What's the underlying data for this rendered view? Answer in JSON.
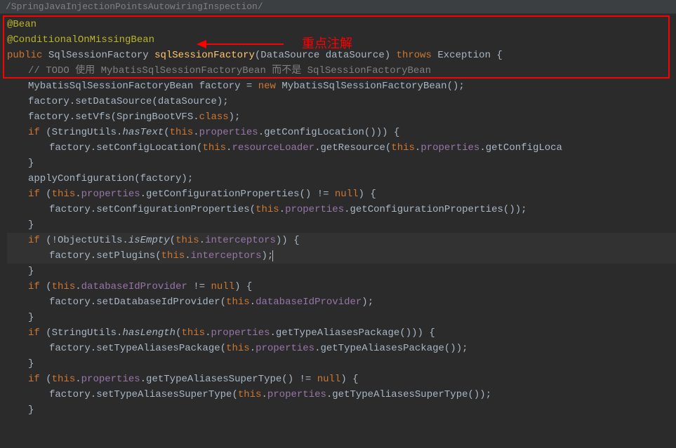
{
  "breadcrumb": "/SpringJavaInjectionPointsAutowiringInspection/",
  "callout": "重点注解",
  "code": {
    "l1_anno1": "@Bean",
    "l2_anno2": "@ConditionalOnMissingBean",
    "l3_kw_public": "public",
    "l3_type": "SqlSessionFactory",
    "l3_name": "sqlSessionFactory",
    "l3_ptype": "DataSource",
    "l3_pname": "dataSource",
    "l3_kw_throws": "throws",
    "l3_exc": "Exception",
    "l4_comment": "// TODO 使用 MybatisSqlSessionFactoryBean 而不是 SqlSessionFactoryBean",
    "l5_type": "MybatisSqlSessionFactoryBean",
    "l5_var": "factory",
    "l5_kw_new": "new",
    "l5_ctor": "MybatisSqlSessionFactoryBean",
    "l6": "factory.setDataSource(dataSource);",
    "l7_a": "factory.setVfs(SpringBootVFS.",
    "l7_kw_class": "class",
    "l7_b": ");",
    "l8_kw_if": "if",
    "l8_a": " (StringUtils.",
    "l8_m": "hasText",
    "l8_b": "(",
    "l8_kw_this": "this",
    "l8_c": ".",
    "l8_f": "properties",
    "l8_d": ".getConfigLocation())) {",
    "l9_a": "factory.setConfigLocation(",
    "l9_kw_this1": "this",
    "l9_b": ".",
    "l9_f1": "resourceLoader",
    "l9_c": ".getResource(",
    "l9_kw_this2": "this",
    "l9_d": ".",
    "l9_f2": "properties",
    "l9_e": ".getConfigLoca",
    "l10": "}",
    "l11": "applyConfiguration(factory);",
    "l12_kw_if": "if",
    "l12_a": " (",
    "l12_kw_this": "this",
    "l12_b": ".",
    "l12_f": "properties",
    "l12_c": ".getConfigurationProperties() != ",
    "l12_kw_null": "null",
    "l12_d": ") {",
    "l13_a": "factory.setConfigurationProperties(",
    "l13_kw_this": "this",
    "l13_b": ".",
    "l13_f": "properties",
    "l13_c": ".getConfigurationProperties());",
    "l14": "}",
    "l15_kw_if": "if",
    "l15_a": " (!ObjectUtils.",
    "l15_m": "isEmpty",
    "l15_b": "(",
    "l15_kw_this": "this",
    "l15_c": ".",
    "l15_f": "interceptors",
    "l15_d": ")) {",
    "l16_a": "factory.setPlugins(",
    "l16_kw_this": "this",
    "l16_b": ".",
    "l16_f": "interceptors",
    "l16_c": ");",
    "l17": "}",
    "l18_kw_if": "if",
    "l18_a": " (",
    "l18_kw_this": "this",
    "l18_b": ".",
    "l18_f": "databaseIdProvider",
    "l18_c": " != ",
    "l18_kw_null": "null",
    "l18_d": ") {",
    "l19_a": "factory.setDatabaseIdProvider(",
    "l19_kw_this": "this",
    "l19_b": ".",
    "l19_f": "databaseIdProvider",
    "l19_c": ");",
    "l20": "}",
    "l21_kw_if": "if",
    "l21_a": " (StringUtils.",
    "l21_m": "hasLength",
    "l21_b": "(",
    "l21_kw_this": "this",
    "l21_c": ".",
    "l21_f": "properties",
    "l21_d": ".getTypeAliasesPackage())) {",
    "l22_a": "factory.setTypeAliasesPackage(",
    "l22_kw_this": "this",
    "l22_b": ".",
    "l22_f": "properties",
    "l22_c": ".getTypeAliasesPackage());",
    "l23": "}",
    "l24_kw_if": "if",
    "l24_a": " (",
    "l24_kw_this": "this",
    "l24_b": ".",
    "l24_f": "properties",
    "l24_c": ".getTypeAliasesSuperType() != ",
    "l24_kw_null": "null",
    "l24_d": ") {",
    "l25_a": "factory.setTypeAliasesSuperType(",
    "l25_kw_this": "this",
    "l25_b": ".",
    "l25_f": "properties",
    "l25_c": ".getTypeAliasesSuperType());",
    "l26": "}"
  }
}
